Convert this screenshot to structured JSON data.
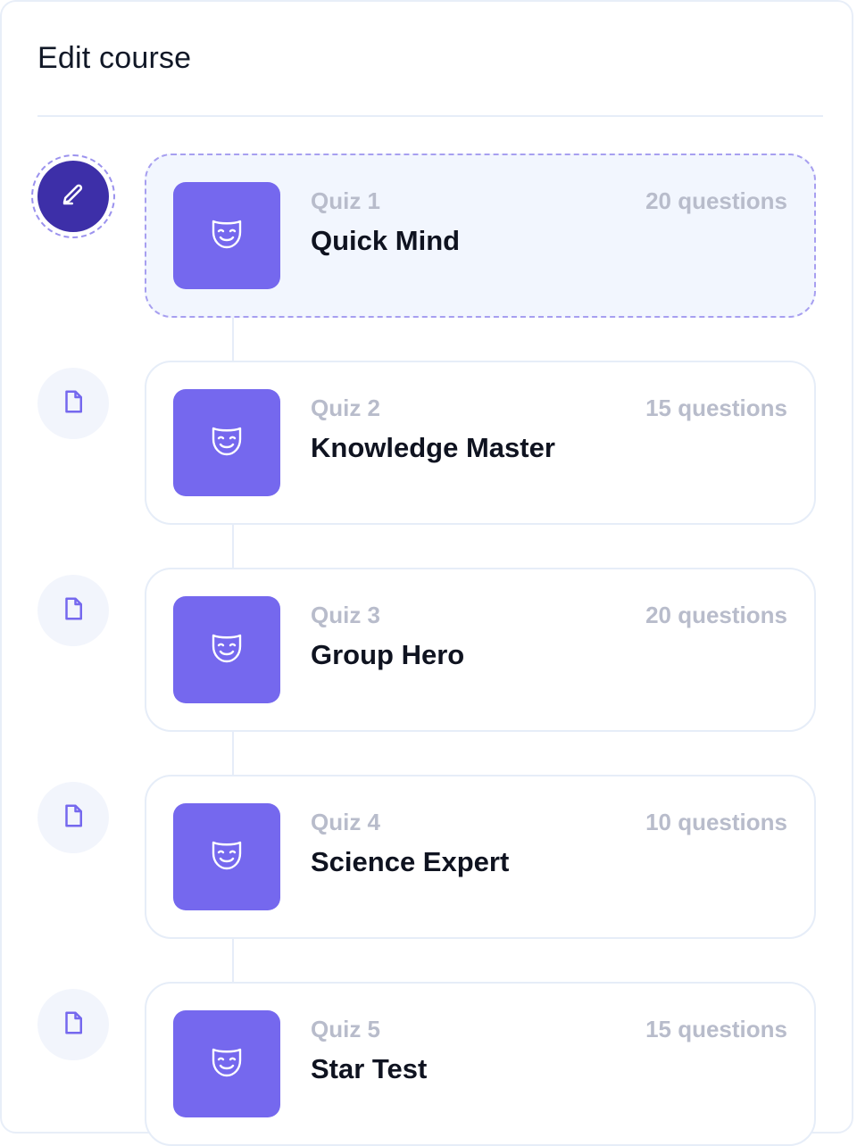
{
  "header": {
    "title": "Edit course"
  },
  "quizzes": [
    {
      "label": "Quiz 1",
      "name": "Quick Mind",
      "count": "20 questions",
      "active": true,
      "step_icon": "pencil-icon",
      "thumb_icon": "mask-icon"
    },
    {
      "label": "Quiz 2",
      "name": "Knowledge Master",
      "count": "15 questions",
      "active": false,
      "step_icon": "file-icon",
      "thumb_icon": "mask-icon"
    },
    {
      "label": "Quiz 3",
      "name": "Group Hero",
      "count": "20 questions",
      "active": false,
      "step_icon": "file-icon",
      "thumb_icon": "mask-icon"
    },
    {
      "label": "Quiz 4",
      "name": "Science Expert",
      "count": "10 questions",
      "active": false,
      "step_icon": "file-icon",
      "thumb_icon": "mask-icon"
    },
    {
      "label": "Quiz 5",
      "name": "Star Test",
      "count": "15 questions",
      "active": false,
      "step_icon": "file-icon",
      "thumb_icon": "mask-icon"
    }
  ],
  "colors": {
    "accent": "#7568ee",
    "active_step": "#3d2fa8",
    "muted_text": "#b8bccb",
    "card_border": "#e6edf8",
    "active_card_bg": "#f2f6fe"
  }
}
